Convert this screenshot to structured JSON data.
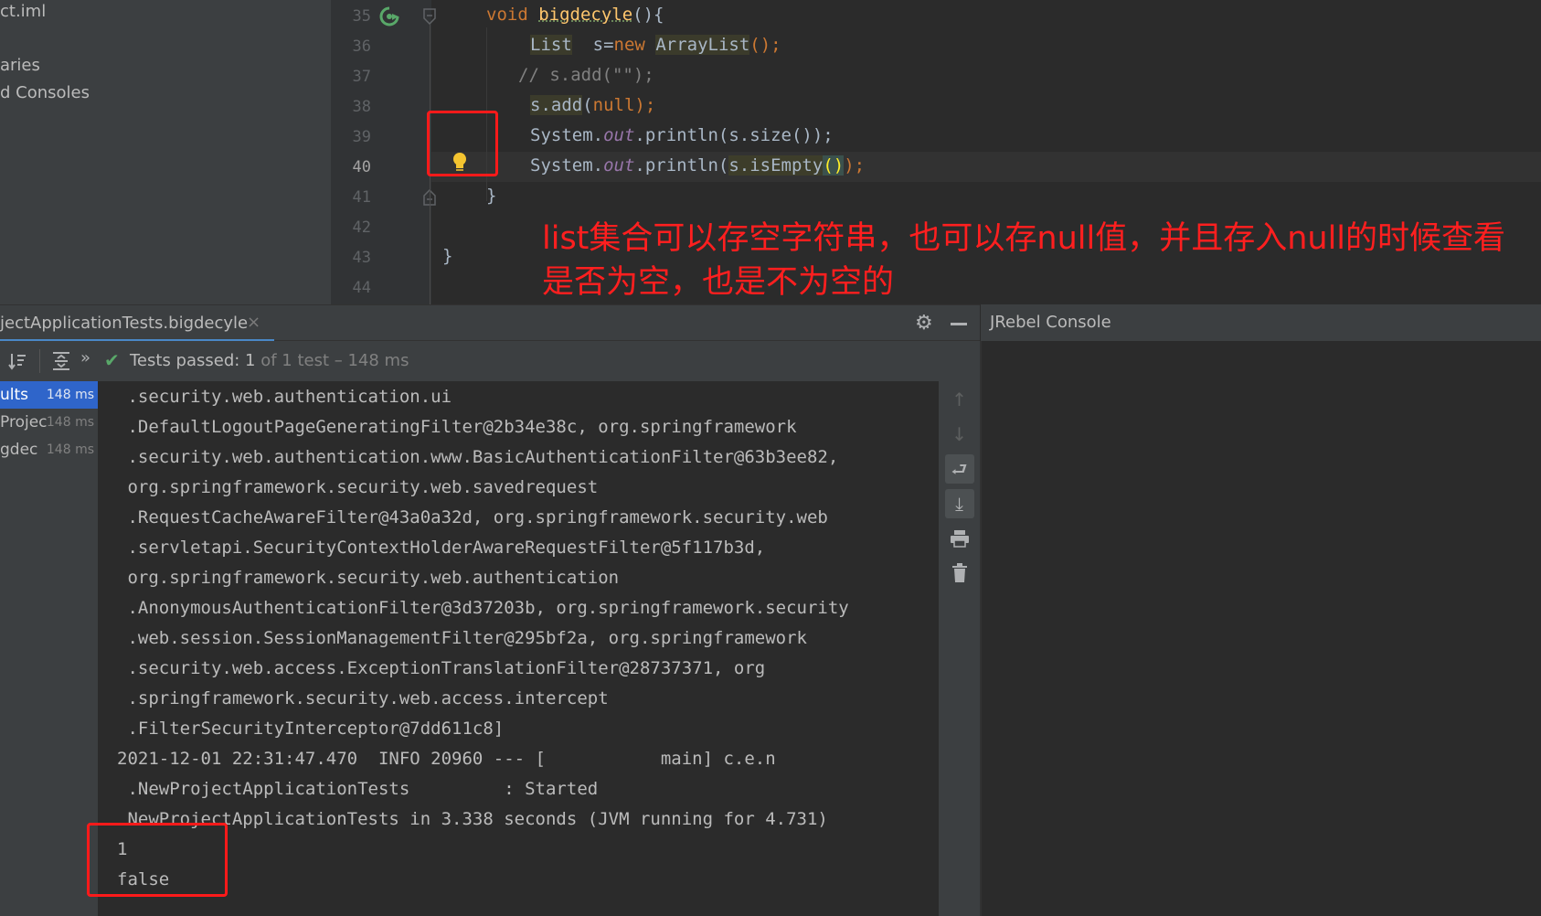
{
  "project_panel": {
    "items": [
      "ct.iml",
      "aries",
      "d Consoles"
    ]
  },
  "editor": {
    "line_numbers": [
      "35",
      "36",
      "37",
      "38",
      "39",
      "40",
      "41",
      "42",
      "43",
      "44"
    ],
    "lines": {
      "l35_kw": "void",
      "l35_fn": "bigdecyle",
      "l35_rest": "(){",
      "l36_type": "List",
      "l36_mid": "  s=",
      "l36_kw": "new",
      "l36_cls": "ArrayList",
      "l36_rest": "();",
      "l37": "// s.add(\"\");",
      "l38_a": "s.add",
      "l38_b": "(",
      "l38_null": "null",
      "l38_c": ");",
      "l39_a": "System.",
      "l39_out": "out",
      "l39_b": ".println(s.size());",
      "l40_a": "System.",
      "l40_out": "out",
      "l40_b": ".println(",
      "l40_c": "s.isEmpty",
      "l40_d": "()",
      "l40_e": ");",
      "l41": "}",
      "l43": "}"
    },
    "annotation_line1": "list集合可以存空字符串，也可以存null值，并且存入null的时候查看",
    "annotation_line2": "是否为空，也是不为空的"
  },
  "run_window": {
    "tab_label": "jectApplicationTests.bigdecyle",
    "tab_close": "×",
    "tests_passed_label": "Tests passed: 1",
    "tests_passed_detail": " of 1 test – 148 ms",
    "tree": [
      {
        "name": "ults",
        "time": "148 ms"
      },
      {
        "name": "Projec",
        "time": "148 ms"
      },
      {
        "name": "gdec",
        "time": "148 ms"
      }
    ],
    "console_lines": [
      " .security.web.authentication.ui",
      " .DefaultLogoutPageGeneratingFilter@2b34e38c, org.springframework",
      " .security.web.authentication.www.BasicAuthenticationFilter@63b3ee82,",
      " org.springframework.security.web.savedrequest",
      " .RequestCacheAwareFilter@43a0a32d, org.springframework.security.web",
      " .servletapi.SecurityContextHolderAwareRequestFilter@5f117b3d,",
      " org.springframework.security.web.authentication",
      " .AnonymousAuthenticationFilter@3d37203b, org.springframework.security",
      " .web.session.SessionManagementFilter@295bf2a, org.springframework",
      " .security.web.access.ExceptionTranslationFilter@28737371, org",
      " .springframework.security.web.access.intercept",
      " .FilterSecurityInterceptor@7dd611c8]",
      "2021-12-01 22:31:47.470  INFO 20960 --- [           main] c.e.n",
      " .NewProjectApplicationTests         : Started",
      " NewProjectApplicationTests in 3.338 seconds (JVM running for 4.731)",
      "1",
      "false"
    ]
  },
  "jrebel": {
    "title": "JRebel Console"
  },
  "colors": {
    "annotation": "#ff1f1f",
    "red_box": "#ff1a1a",
    "selection": "#2f65ca",
    "pass_check": "#59a869"
  }
}
